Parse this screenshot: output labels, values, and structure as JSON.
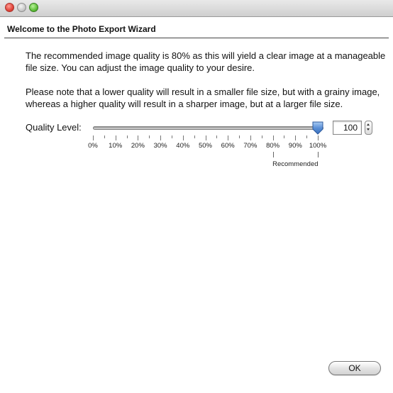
{
  "window": {
    "title": ""
  },
  "header": {
    "title": "Welcome to the Photo Export Wizard"
  },
  "content": {
    "paragraph1": "The recommended image quality is 80% as this will yield a clear image at a manageable file size. You can adjust the image quality to your desire.",
    "paragraph2": "Please note that a lower quality will result in a smaller file size, but with a grainy image, whereas a higher quality will result in a sharper image, but at a larger file size."
  },
  "quality": {
    "label": "Quality Level:",
    "value": 100,
    "value_text": "100",
    "min": 0,
    "max": 100,
    "tick_labels": [
      "0%",
      "10%",
      "20%",
      "30%",
      "40%",
      "50%",
      "60%",
      "70%",
      "80%",
      "90%",
      "100%"
    ],
    "recommended_value": 80,
    "recommended_label": "Recommended"
  },
  "buttons": {
    "ok_label": "OK"
  },
  "icons": {
    "close": "close-traffic-light-icon",
    "minimize": "minimize-traffic-light-icon",
    "zoom": "zoom-traffic-light-icon",
    "stepper_up": "chevron-up-icon",
    "stepper_down": "chevron-down-icon"
  },
  "colors": {
    "thumb": "#5a8fd6",
    "close": "#e0443a",
    "zoom": "#5fbf3a"
  }
}
